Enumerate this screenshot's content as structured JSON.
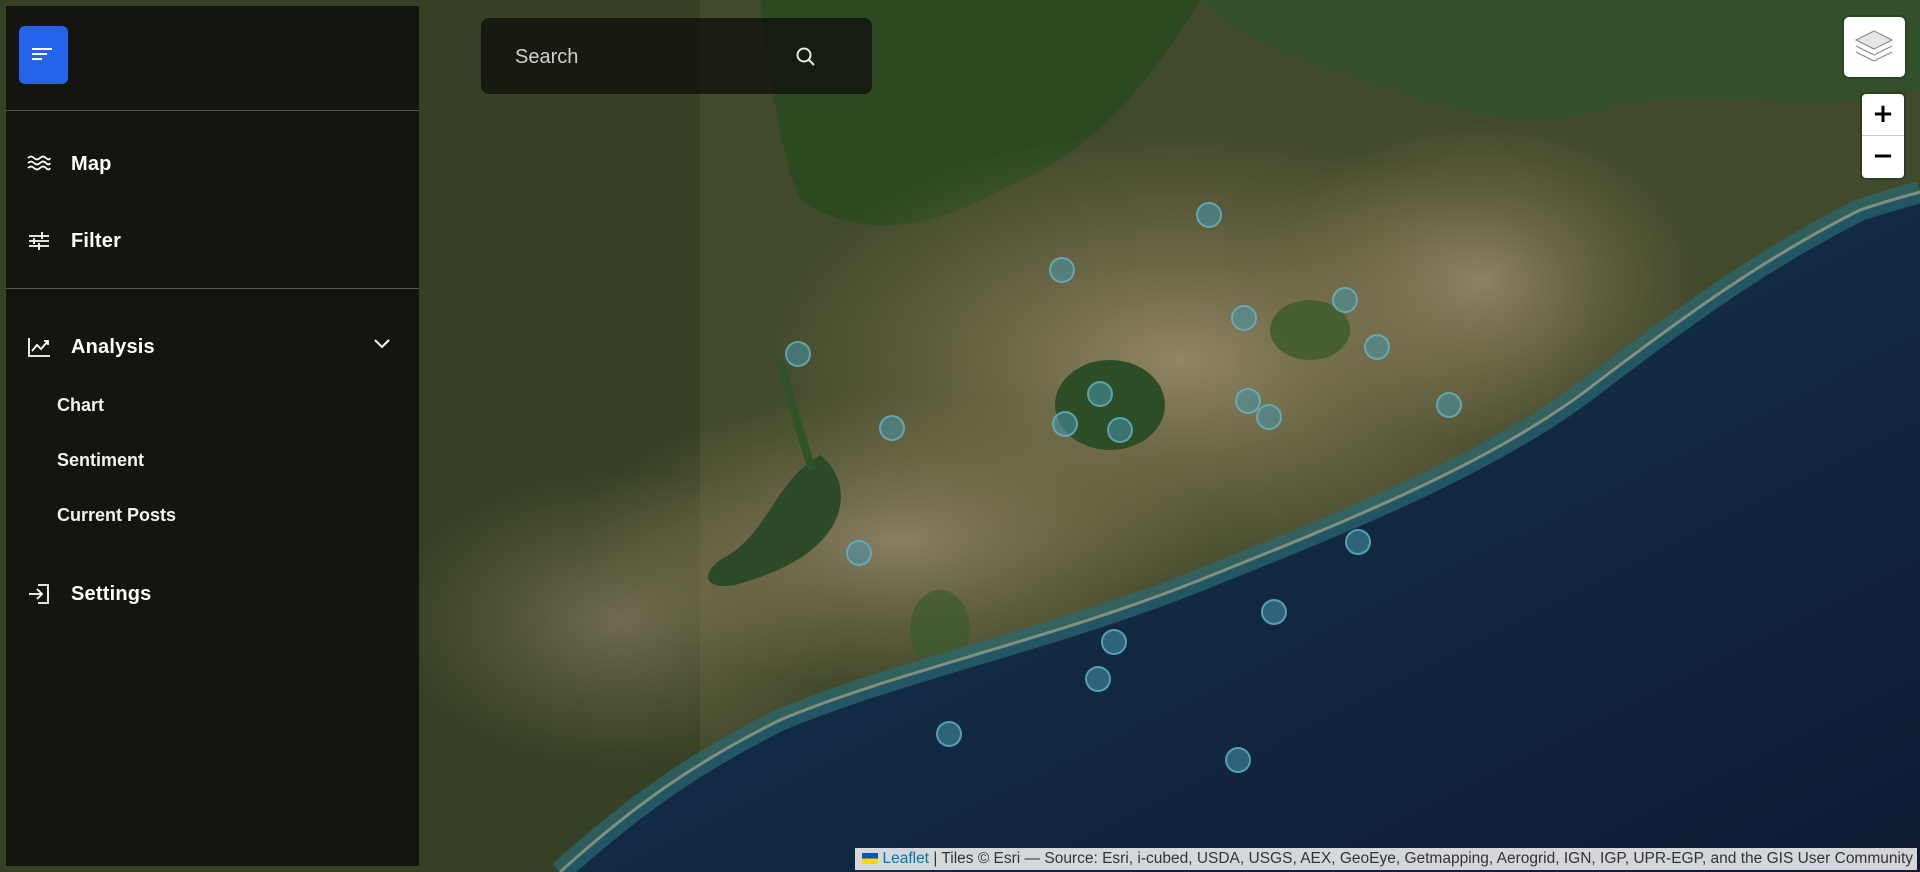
{
  "sidebar": {
    "menu_icon": "menu-lines-icon",
    "accent_color": "#2563eb",
    "items": {
      "map": {
        "label": "Map",
        "icon": "waves-icon"
      },
      "filter": {
        "label": "Filter",
        "icon": "sliders-icon"
      },
      "analysis": {
        "label": "Analysis",
        "icon": "trend-chart-icon",
        "expanded": true
      },
      "settings": {
        "label": "Settings",
        "icon": "sign-in-icon"
      }
    },
    "analysis_subitems": {
      "chart": "Chart",
      "sentiment": "Sentiment",
      "current_posts": "Current Posts"
    }
  },
  "search": {
    "placeholder": "Search",
    "icon": "search-icon"
  },
  "map_controls": {
    "layers_icon": "layers-icon",
    "zoom_in": "+",
    "zoom_out": "−"
  },
  "map": {
    "basemap": "satellite imagery",
    "marker_count": 21,
    "marker_color": "#4696aa"
  },
  "attribution": {
    "leaflet": "Leaflet",
    "text": "| Tiles © Esri — Source: Esri, i-cubed, USDA, USGS, AEX, GeoEye, Getmapping, Aerogrid, IGN, IGP, UPR-EGP, and the GIS User Community"
  }
}
